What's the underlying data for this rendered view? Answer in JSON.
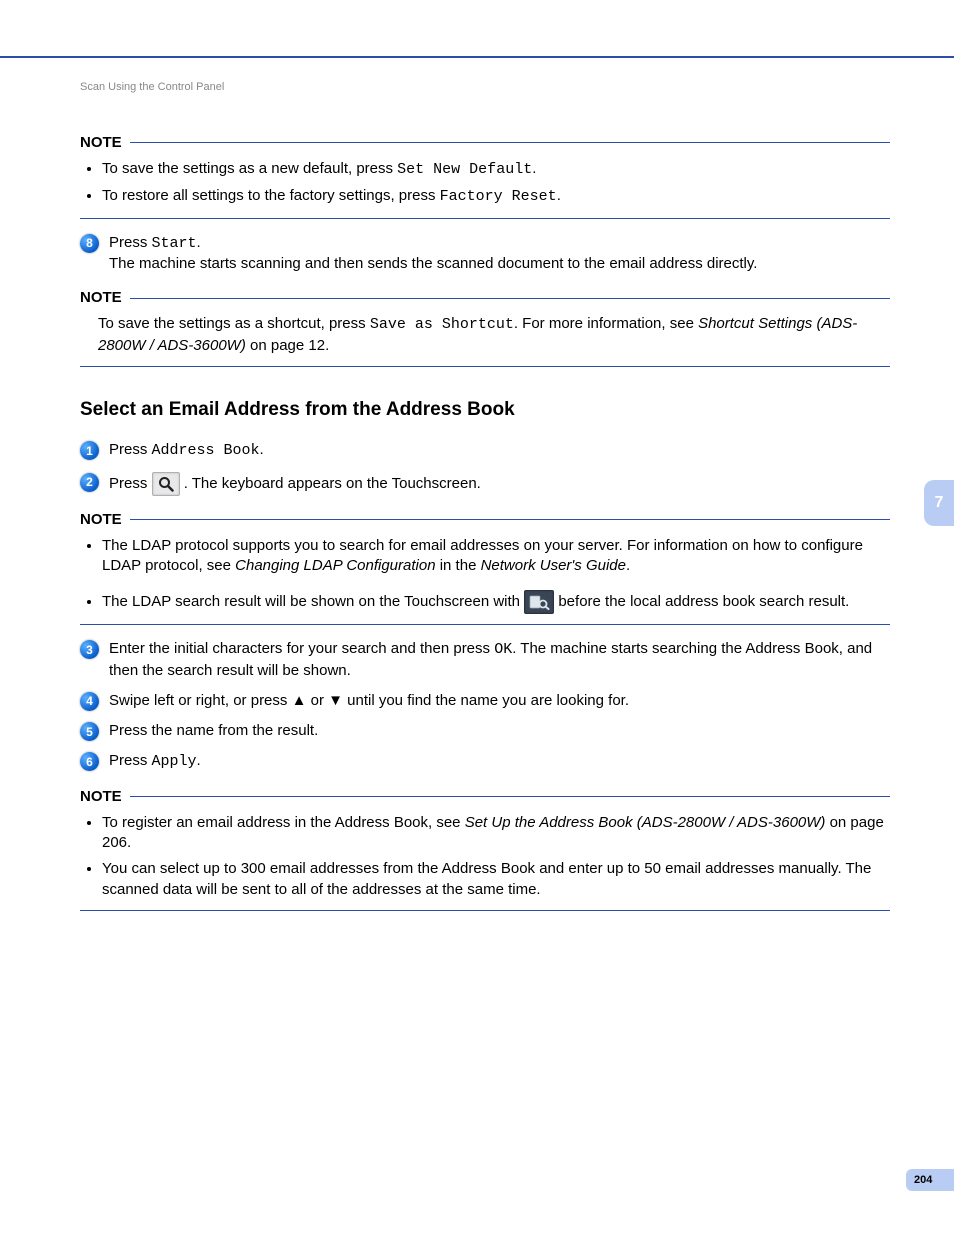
{
  "breadcrumb": "Scan Using the Control Panel",
  "note_label": "NOTE",
  "note1": {
    "b1_a": "To save the settings as a new default, press ",
    "b1_b": "Set New Default",
    "b1_c": ".",
    "b2_a": "To restore all settings to the factory settings, press ",
    "b2_b": "Factory Reset",
    "b2_c": "."
  },
  "step8": {
    "num": "8",
    "l1a": "Press ",
    "l1b": "Start",
    "l1c": ".",
    "l2": "The machine starts scanning and then sends the scanned document to the email address directly."
  },
  "note2": {
    "t1": "To save the settings as a shortcut, press ",
    "t2": "Save as Shortcut",
    "t3": ". For more information, see ",
    "t4": "Shortcut Settings (ADS-2800W / ADS-3600W)",
    "t5": " on page 12."
  },
  "section_title": "Select an Email Address from the Address Book",
  "s1": {
    "num": "1",
    "a": "Press ",
    "b": "Address Book",
    "c": "."
  },
  "s2": {
    "num": "2",
    "a": "Press ",
    "c": ". The keyboard appears on the Touchscreen."
  },
  "note3": {
    "b1a": "The LDAP protocol supports you to search for email addresses on your server. For information on how to configure LDAP protocol, see ",
    "b1b": "Changing LDAP Configuration",
    "b1c": " in the ",
    "b1d": "Network User's Guide",
    "b1e": ".",
    "b2a": "The LDAP search result will be shown on the Touchscreen with ",
    "b2b": " before the local address book search result."
  },
  "s3": {
    "num": "3",
    "a": "Enter the initial characters for your search and then press ",
    "b": "OK",
    "c": ". The machine starts searching the Address Book, and then the search result will be shown."
  },
  "s4": {
    "num": "4",
    "a": "Swipe left or right, or press ",
    "up": "▲",
    "mid": " or ",
    "down": "▼",
    "b": " until you find the name you are looking for."
  },
  "s5": {
    "num": "5",
    "a": "Press the name from the result."
  },
  "s6": {
    "num": "6",
    "a": "Press ",
    "b": "Apply",
    "c": "."
  },
  "note4": {
    "b1a": "To register an email address in the Address Book, see ",
    "b1b": "Set Up the Address Book (ADS-2800W / ADS-3600W)",
    "b1c": " on page 206.",
    "b2": "You can select up to 300 email addresses from the Address Book and enter up to 50 email addresses manually. The scanned data will be sent to all of the addresses at the same time."
  },
  "side_tab": "7",
  "page_number": "204"
}
